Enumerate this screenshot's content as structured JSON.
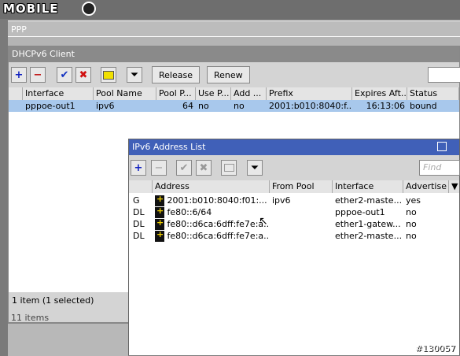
{
  "logo": {
    "text": "MOBILE"
  },
  "watermark": "#130057",
  "bg_windows": {
    "ppp_title": "PPP",
    "items_text": "11 items"
  },
  "dhcp": {
    "title": "DHCPv6 Client",
    "toolbar": {
      "add_icon": "plus-icon",
      "remove_icon": "minus-icon",
      "enable_icon": "check-icon",
      "disable_icon": "x-icon",
      "comment_icon": "note-icon",
      "filter_icon": "filter-icon",
      "release_label": "Release",
      "renew_label": "Renew"
    },
    "columns": [
      "Interface",
      "Pool Name",
      "Pool P...",
      "Use P...",
      "Add ...",
      "Prefix",
      "Expires Aft...",
      "Status"
    ],
    "rows": [
      {
        "interface": "pppoe-out1",
        "pool_name": "ipv6",
        "pool_p": "64",
        "use_p": "no",
        "add": "no",
        "prefix": "2001:b010:8040:f...",
        "expires": "16:13:06",
        "status": "bound"
      }
    ],
    "status_text": "1 item (1 selected)"
  },
  "ipv6": {
    "title": "IPv6 Address List",
    "find_placeholder": "Find",
    "columns": [
      "Address",
      "From Pool",
      "Interface",
      "Advertise"
    ],
    "rows": [
      {
        "flag": "G",
        "address": "2001:b010:8040:f01:...",
        "from_pool": "ipv6",
        "interface": "ether2-maste...",
        "advertise": "yes"
      },
      {
        "flag": "DL",
        "address": "fe80::6/64",
        "from_pool": "",
        "interface": "pppoe-out1",
        "advertise": "no"
      },
      {
        "flag": "DL",
        "address": "fe80::d6ca:6dff:fe7e:a...",
        "from_pool": "",
        "interface": "ether1-gatew...",
        "advertise": "no"
      },
      {
        "flag": "DL",
        "address": "fe80::d6ca:6dff:fe7e:a...",
        "from_pool": "",
        "interface": "ether2-maste...",
        "advertise": "no"
      }
    ]
  }
}
